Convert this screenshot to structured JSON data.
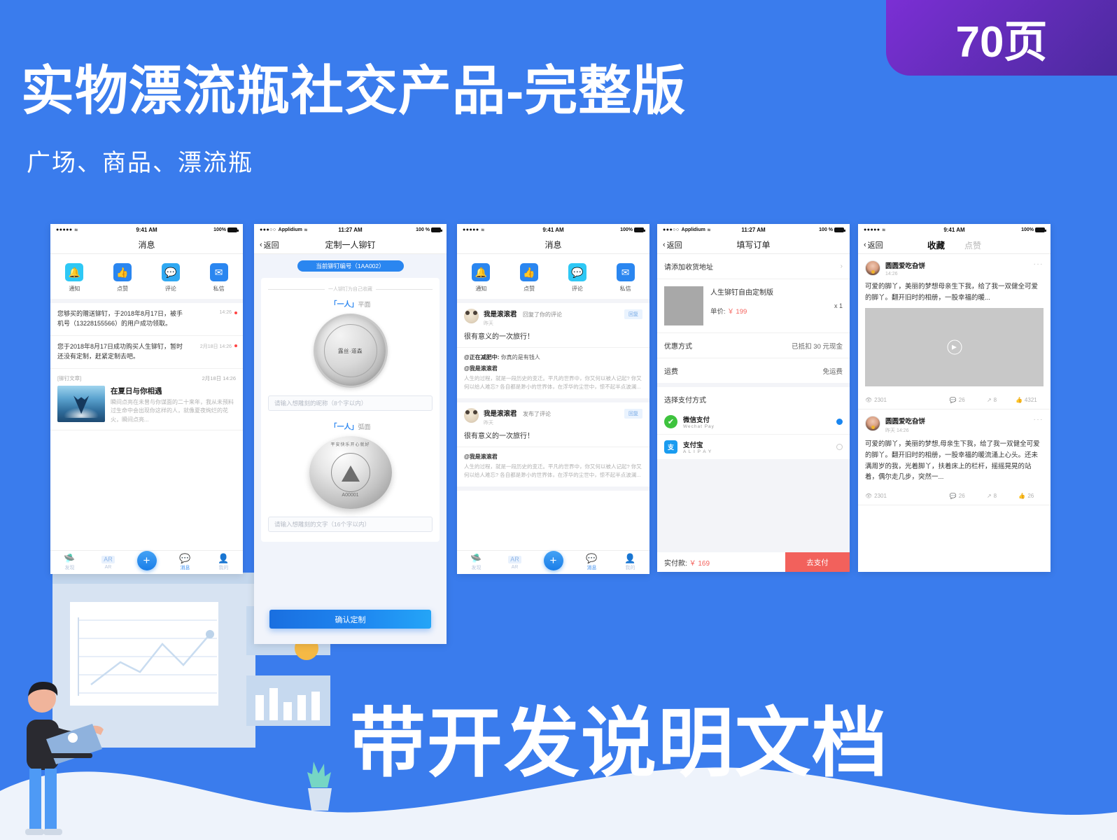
{
  "banner": {
    "title": "实物漂流瓶社交产品-完整版",
    "subtitle": "广场、商品、漂流瓶",
    "pages_badge": "70页",
    "footer_title": "带开发说明文档",
    "bg_color": "#3a7ced",
    "badge_color": "#7b2fd4"
  },
  "screen1": {
    "status": {
      "dots": "●●●●●",
      "wifi": "≈",
      "time": "9:41 AM",
      "battery": "100%"
    },
    "nav_title": "消息",
    "icons": [
      {
        "label": "通知",
        "glyph": "bell-icon",
        "char": "♁",
        "color": "#2ec8f5"
      },
      {
        "label": "点赞",
        "glyph": "thumbs-up-icon",
        "char": "☝",
        "color": "#2a86f0"
      },
      {
        "label": "评论",
        "glyph": "comment-icon",
        "char": "☺",
        "color": "#2fa8f2"
      },
      {
        "label": "私信",
        "glyph": "mail-icon",
        "char": "✉",
        "color": "#2a86f0"
      }
    ],
    "messages": [
      {
        "text": "您够买的赠送铆钉，于2018年8月17日，被手机号（13228155566）的用户成功领取。",
        "time": "14:26",
        "unread": true
      },
      {
        "text": "您于2018年8月17日成功购买人生铆钉，暂时还没有定制，赶紧定制去吧。",
        "time": "2月18日 14:26",
        "unread": true
      }
    ],
    "article": {
      "tag": "[铆钉文章]",
      "time": "2月18日 14:26",
      "title": "在夏日与你相遇",
      "desc": "瞬间点亮在未曾与你谋面的二十来年，我从未预料过生命中会出现你这样的人，就像夏夜绚烂的花火，瞬间点亮..."
    },
    "tabbar": [
      {
        "label": "发现",
        "char": "◔",
        "active": false
      },
      {
        "label": "AR",
        "char": "▦",
        "active": false
      },
      {
        "label": "+",
        "char": "+",
        "active": false
      },
      {
        "label": "消息",
        "char": "●",
        "active": true
      },
      {
        "label": "我的",
        "char": "●",
        "active": false
      }
    ]
  },
  "screen2": {
    "status": {
      "dots": "●●●○○",
      "carrier": "Applidium",
      "wifi": "≈",
      "time": "11:27 AM",
      "battery": "100 %"
    },
    "back_label": "返回",
    "nav_title": "定制一人铆钉",
    "badge_pill": "当前铆钉编号（1AA002）",
    "divider_text": "一人铆钉为自己收藏",
    "face1_label_quoted": "「一人」",
    "face1_label_rest": "平面",
    "coin1_text": "露丝·道森",
    "input1_placeholder": "请输入想雕刻的昵称（8个字以内）",
    "face2_label_quoted": "「一人」",
    "face2_label_rest": "弧面",
    "coin2_arc_text": "平安快乐开心就好",
    "coin2_serial": "A00001",
    "input2_placeholder": "请输入想雕刻的文字（16个字以内）",
    "cta_label": "确认定制"
  },
  "screen3": {
    "status": {
      "dots": "●●●●●",
      "wifi": "≈",
      "time": "9:41 AM",
      "battery": "100%"
    },
    "nav_title": "消息",
    "icons": [
      {
        "label": "通知",
        "glyph": "bell-icon",
        "char": "♁",
        "color": "#2a86f0"
      },
      {
        "label": "点赞",
        "glyph": "thumbs-up-icon",
        "char": "☝",
        "color": "#2a86f0"
      },
      {
        "label": "评论",
        "glyph": "comment-icon",
        "char": "☺",
        "color": "#2ec8f5"
      },
      {
        "label": "私信",
        "glyph": "mail-icon",
        "char": "✉",
        "color": "#2a86f0"
      }
    ],
    "comments": [
      {
        "name": "我是滚滚君",
        "action": "回复了你的评论",
        "time": "昨天",
        "reply_btn": "回复",
        "body": "很有意义的一次旅行！",
        "quotes": [
          {
            "who": "@正在减肥中:",
            "text": "你真的是有钱人",
            "inline": true
          },
          {
            "who": "@我是滚滚君",
            "text": "人生的过程，就是一段历史的变迁。平凡的世界中，你又何以被人记起? 你又何以给人难忘? 各自都是渺小的世界体，在浮华的尘世中，惊不起半点波澜...",
            "inline": false
          }
        ]
      },
      {
        "name": "我是滚滚君",
        "action": "发布了评论",
        "time": "昨天",
        "reply_btn": "回复",
        "body": "很有意义的一次旅行！",
        "quotes": [
          {
            "who": "@我是滚滚君",
            "text": "人生的过程，就是一段历史的变迁。平凡的世界中，你又何以被人记起? 你又何以给人难忘? 各自都是渺小的世界体，在浮华的尘世中，惊不起半点波澜...",
            "inline": false
          }
        ]
      }
    ],
    "tabbar": [
      {
        "label": "发现",
        "char": "◔",
        "active": false
      },
      {
        "label": "AR",
        "char": "▦",
        "active": false
      },
      {
        "label": "+",
        "char": "+",
        "active": false
      },
      {
        "label": "消息",
        "char": "●",
        "active": true
      },
      {
        "label": "我的",
        "char": "●",
        "active": false
      }
    ]
  },
  "screen4": {
    "status": {
      "dots": "●●●○○",
      "carrier": "Applidium",
      "wifi": "≈",
      "time": "11:27 AM",
      "battery": "100 %"
    },
    "back_label": "返回",
    "nav_title": "填写订单",
    "address_row": "请添加收货地址",
    "product": {
      "name": "人生铆钉自由定制版",
      "price_label": "单价:",
      "price": "￥ 199",
      "qty": "x 1"
    },
    "discount_label": "优惠方式",
    "discount_value": "已抵扣 30 元现金",
    "shipping_label": "运费",
    "shipping_value": "免运费",
    "pay_section_title": "选择支付方式",
    "pay_methods": [
      {
        "name": "微信支付",
        "sub": "Wechat Pay",
        "selected": true,
        "color": "#3ec33e",
        "char": "✔"
      },
      {
        "name": "支付宝",
        "sub": "A L I P A Y",
        "selected": false,
        "color": "#1a9cf0",
        "char": "支"
      }
    ],
    "total_label": "实付款:",
    "total_value": "￥ 169",
    "pay_button": "去支付"
  },
  "screen5": {
    "status": {
      "dots": "●●●●●",
      "wifi": "≈",
      "time": "9:41 AM",
      "battery": "100%"
    },
    "back_label": "返回",
    "tabs": [
      {
        "label": "收藏",
        "active": true
      },
      {
        "label": "点赞",
        "active": false
      }
    ],
    "posts": [
      {
        "name": "圆圆爱吃旮饼",
        "time": "14:26",
        "text": "可爱的脚丫，美丽的梦想母亲生下我，给了我一双健全可爱的脚丫。翻开旧时的相册，一股幸福的暖...",
        "has_media": true,
        "stats": {
          "views": "2301",
          "comments": "26",
          "shares": "8",
          "likes": "4321"
        }
      },
      {
        "name": "圆圆爱吃旮饼",
        "time": "昨天 14:26",
        "text": "可爱的脚丫，美丽的梦想,母亲生下我，给了我一双健全可爱的脚丫。翻开旧时的相册，一股幸福的暖流涌上心头。还未满周岁的我，光着脚丫，扶着床上的栏杆，摇摇晃晃的站着，偶尔走几步，突然一...",
        "has_media": false,
        "stats": {
          "views": "2301",
          "comments": "26",
          "shares": "8",
          "likes": "26"
        }
      }
    ]
  }
}
